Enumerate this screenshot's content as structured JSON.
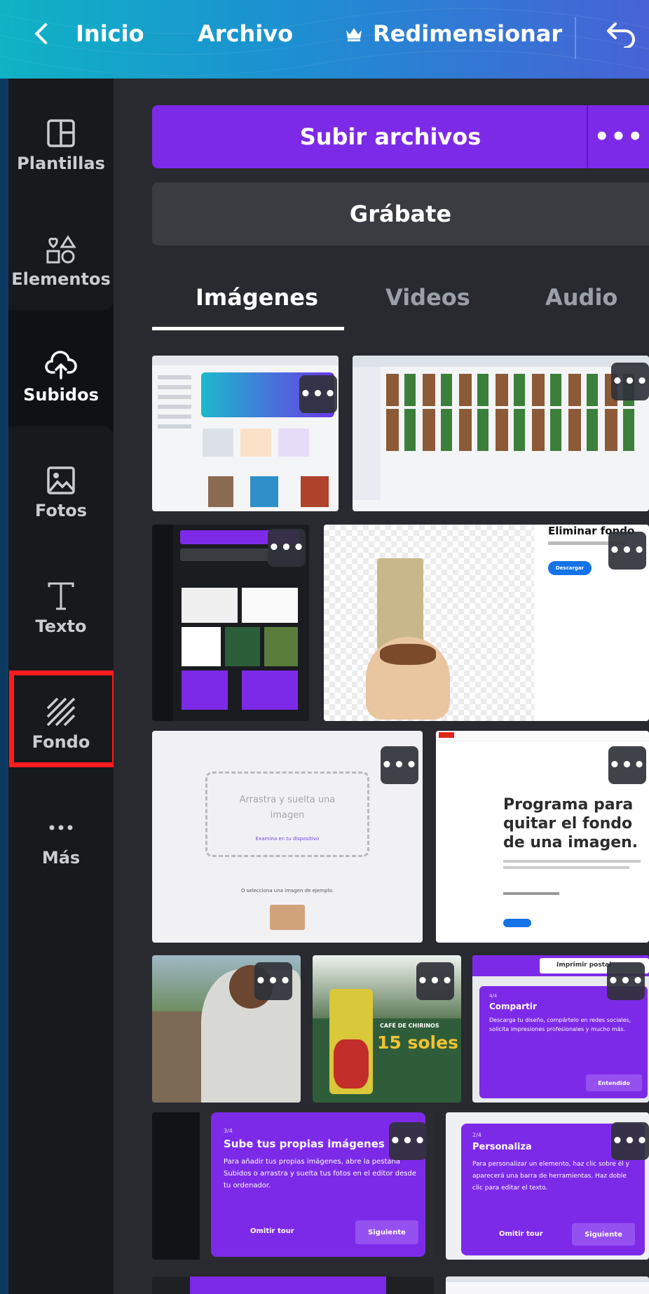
{
  "topbar": {
    "back_label": "Inicio",
    "file_label": "Archivo",
    "resize_label": "Redimensionar"
  },
  "sidebar": {
    "items": [
      {
        "label": "Plantillas",
        "icon": "templates-icon"
      },
      {
        "label": "Elementos",
        "icon": "elements-icon"
      },
      {
        "label": "Subidos",
        "icon": "upload-cloud-icon"
      },
      {
        "label": "Fotos",
        "icon": "photos-icon"
      },
      {
        "label": "Texto",
        "icon": "text-icon"
      },
      {
        "label": "Fondo",
        "icon": "background-icon"
      },
      {
        "label": "Más",
        "icon": "more-icon"
      }
    ]
  },
  "panel": {
    "upload_label": "Subir archivos",
    "more_label": "•••",
    "record_label": "Grábate",
    "tabs": [
      "Imágenes",
      "Videos",
      "Audio"
    ]
  },
  "thumbs": {
    "t4_title": "Eliminar fondo",
    "t4_btn": "Descargar",
    "t5_text": "Arrastra y suelta una imagen",
    "t5_link": "Examina en tu dispositivo",
    "t5_sub": "O selecciona una imagen de ejemplo:",
    "t6_title": "Programa para quitar el fondo de una imagen.",
    "t8_brand": "CAFÉ DE CHIRINOS",
    "t8_price": "15 soles",
    "t9_step": "4/4",
    "t9_title": "Compartir",
    "t9_body": "Descarga tu diseño, compártelo en redes sociales, solicita impresiones profesionales y mucho más.",
    "t9_btn": "Entendido",
    "t9_top": "Imprimir postal",
    "t10_step": "3/4",
    "t10_title": "Sube tus propias imágenes",
    "t10_body": "Para añadir tus propias imágenes, abre la pestaña Subidos o arrastra y suelta tus fotos en el editor desde tu ordenador.",
    "t10_skip": "Omitir tour",
    "t10_next": "Siguiente",
    "t11_step": "2/4",
    "t11_title": "Personaliza",
    "t11_body": "Para personalizar un elemento, haz clic sobre él y aparecerá una barra de herramientas. Haz doble clic para editar el texto.",
    "t11_skip": "Omitir tour",
    "t11_next": "Siguiente"
  },
  "colors": {
    "purple": "#7d2ae8",
    "highlight": "#ff1c1c"
  }
}
